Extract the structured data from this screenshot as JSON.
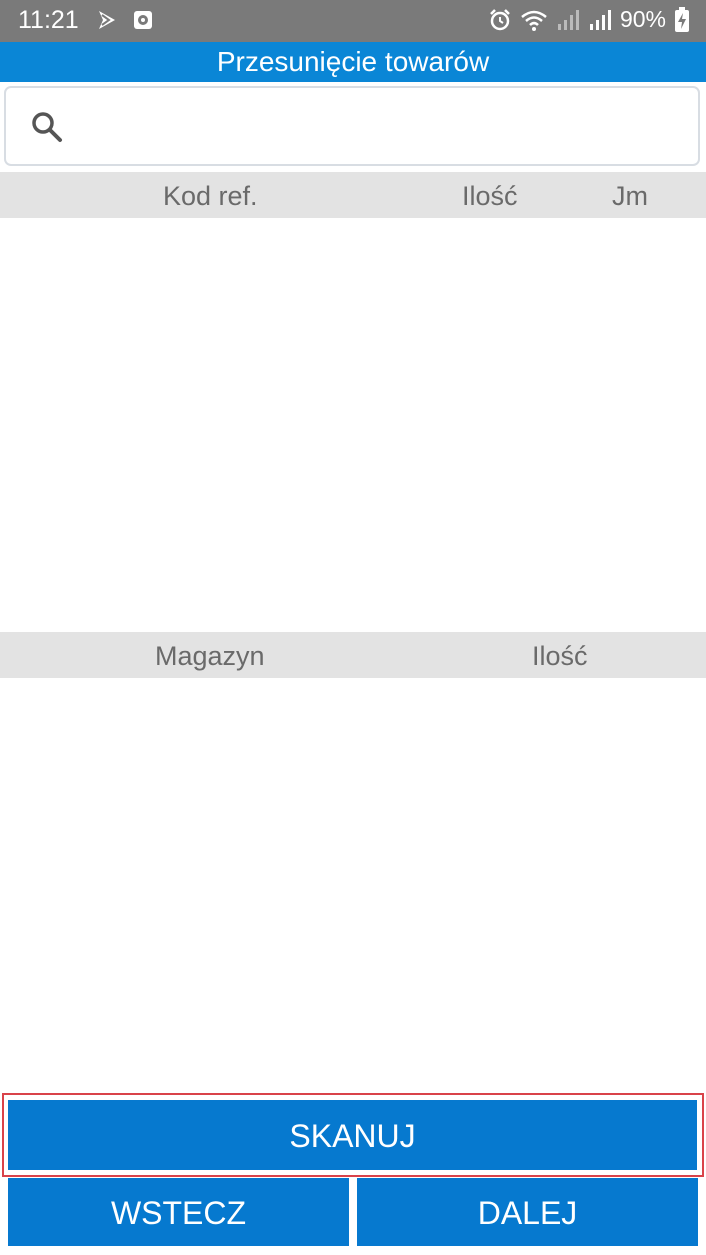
{
  "status_bar": {
    "time": "11:21",
    "battery": "90%",
    "icons": [
      "notification-flag-icon",
      "notification-app-icon",
      "alarm-icon",
      "wifi-icon",
      "signal-icon",
      "signal-icon",
      "battery-charging-icon"
    ]
  },
  "header": {
    "title": "Przesunięcie towarów"
  },
  "search": {
    "value": "",
    "placeholder": "",
    "icon": "search-icon"
  },
  "items_table": {
    "columns": [
      "Kod ref.",
      "Ilość",
      "Jm"
    ],
    "rows": []
  },
  "stock_table": {
    "columns": [
      "Magazyn",
      "Ilość"
    ],
    "rows": []
  },
  "buttons": {
    "scan": "SKANUJ",
    "back": "WSTECZ",
    "next": "DALEJ"
  },
  "colors": {
    "accent": "#0a86d6",
    "button": "#0679cf",
    "highlight_border": "#d9434a",
    "header_bg": "#e3e3e3"
  }
}
